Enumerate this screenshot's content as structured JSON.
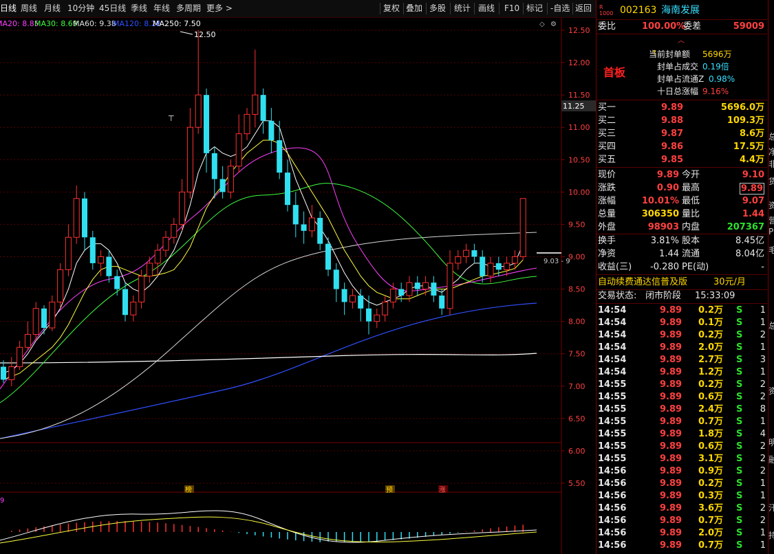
{
  "toolbar": {
    "tabs": [
      "日线",
      "周线",
      "月线",
      "10分钟",
      "45日线",
      "季线",
      "年线",
      "多周期",
      "更多 >"
    ],
    "actions": [
      "复权",
      "叠加",
      "多股",
      "统计",
      "画线",
      "F10",
      "标记",
      "-自选",
      "返回"
    ]
  },
  "ma_legend": [
    {
      "label": "MA20: 8.85",
      "color": "#ff40ff"
    },
    {
      "label": "MA30: 8.69",
      "color": "#40ff40"
    },
    {
      "label": "MA60: 9.38",
      "color": "#e0e0e0"
    },
    {
      "label": "MA120: 8.28",
      "color": "#3050ff"
    },
    {
      "label": "MA250: 7.50",
      "color": "#ffffff"
    }
  ],
  "chart_labels": {
    "high_marker": "12.50",
    "last_price_tag": "11.25",
    "low_marker": "9.03 - 9",
    "events": [
      "榜",
      "预",
      "涨"
    ],
    "macd_marker": "9"
  },
  "price_axis": [
    "12.50",
    "12.00",
    "11.50",
    "11.00",
    "10.50",
    "10.00",
    "9.50",
    "9.00",
    "8.50",
    "8.00",
    "7.50",
    "7.00",
    "6.50",
    "6.00",
    "5.50"
  ],
  "colors": {
    "up": "#ff3030",
    "down": "#30e0f0",
    "ma5": "#ffffff",
    "ma10": "#ffff40",
    "ma20": "#ff40ff",
    "ma30": "#40ff40",
    "ma60": "#e0e0e0",
    "ma120": "#3050ff",
    "ma250": "#ffffff"
  },
  "chart_data": {
    "type": "candlestick",
    "ylim": [
      5.3,
      12.7
    ],
    "candles": [
      [
        7.3,
        7.1,
        7.4,
        7.05
      ],
      [
        7.1,
        7.3,
        7.45,
        7.0
      ],
      [
        7.3,
        7.6,
        7.7,
        7.25
      ],
      [
        7.6,
        7.8,
        8.0,
        7.55
      ],
      [
        7.8,
        8.2,
        8.3,
        7.7
      ],
      [
        8.2,
        7.9,
        8.25,
        7.8
      ],
      [
        7.9,
        8.3,
        8.4,
        7.85
      ],
      [
        8.3,
        8.8,
        8.9,
        8.2
      ],
      [
        8.8,
        9.3,
        9.5,
        8.7
      ],
      [
        9.3,
        9.9,
        10.1,
        9.2
      ],
      [
        9.9,
        9.3,
        10.0,
        9.1
      ],
      [
        9.3,
        8.9,
        9.4,
        8.8
      ],
      [
        8.9,
        9.0,
        9.1,
        8.7
      ],
      [
        9.0,
        8.7,
        9.1,
        8.6
      ],
      [
        8.7,
        8.5,
        8.8,
        8.4
      ],
      [
        8.5,
        8.1,
        8.6,
        8.0
      ],
      [
        8.1,
        8.3,
        8.4,
        8.0
      ],
      [
        8.3,
        8.7,
        8.8,
        8.2
      ],
      [
        8.7,
        8.9,
        9.0,
        8.6
      ],
      [
        8.9,
        9.1,
        9.2,
        8.7
      ],
      [
        9.1,
        9.3,
        9.4,
        9.0
      ],
      [
        9.3,
        9.5,
        9.6,
        9.2
      ],
      [
        9.5,
        10.0,
        10.2,
        9.4
      ],
      [
        10.0,
        11.0,
        11.3,
        9.9
      ],
      [
        11.0,
        11.5,
        12.5,
        10.9
      ],
      [
        11.5,
        10.6,
        11.6,
        10.3
      ],
      [
        10.6,
        10.2,
        10.7,
        9.9
      ],
      [
        10.2,
        10.0,
        10.4,
        9.9
      ],
      [
        10.0,
        10.4,
        10.5,
        9.9
      ],
      [
        10.4,
        10.9,
        11.2,
        10.3
      ],
      [
        10.9,
        11.2,
        11.3,
        10.8
      ],
      [
        11.2,
        11.5,
        12.2,
        11.0
      ],
      [
        11.5,
        11.1,
        11.6,
        10.9
      ],
      [
        11.1,
        10.8,
        11.3,
        10.6
      ],
      [
        10.8,
        10.3,
        11.1,
        10.2
      ],
      [
        10.3,
        9.8,
        10.5,
        9.7
      ],
      [
        9.8,
        9.5,
        10.0,
        9.3
      ],
      [
        9.5,
        9.4,
        9.7,
        9.2
      ],
      [
        9.4,
        9.6,
        9.8,
        9.3
      ],
      [
        9.6,
        9.2,
        9.7,
        9.1
      ],
      [
        9.2,
        8.8,
        9.3,
        8.7
      ],
      [
        8.8,
        8.5,
        8.9,
        8.3
      ],
      [
        8.5,
        8.3,
        8.6,
        8.1
      ],
      [
        8.3,
        8.4,
        8.5,
        8.2
      ],
      [
        8.4,
        8.2,
        8.5,
        8.0
      ],
      [
        8.2,
        8.0,
        8.4,
        7.8
      ],
      [
        8.0,
        8.1,
        8.2,
        7.9
      ],
      [
        8.1,
        8.3,
        8.4,
        8.0
      ],
      [
        8.3,
        8.5,
        8.6,
        8.2
      ],
      [
        8.5,
        8.4,
        8.6,
        8.3
      ],
      [
        8.4,
        8.6,
        8.7,
        8.3
      ],
      [
        8.6,
        8.5,
        8.7,
        8.4
      ],
      [
        8.5,
        8.6,
        8.7,
        8.4
      ],
      [
        8.6,
        8.4,
        8.7,
        8.3
      ],
      [
        8.4,
        8.2,
        8.5,
        8.1
      ],
      [
        8.2,
        8.9,
        9.1,
        8.1
      ],
      [
        8.9,
        9.0,
        9.1,
        8.8
      ],
      [
        9.0,
        9.1,
        9.2,
        8.9
      ],
      [
        9.1,
        9.0,
        9.2,
        8.9
      ],
      [
        9.0,
        8.7,
        9.1,
        8.6
      ],
      [
        8.7,
        8.9,
        9.0,
        8.6
      ],
      [
        8.9,
        8.8,
        9.0,
        8.7
      ],
      [
        8.8,
        8.9,
        9.0,
        8.7
      ],
      [
        8.9,
        9.0,
        9.1,
        8.8
      ],
      [
        9.0,
        9.9,
        9.9,
        8.95
      ]
    ],
    "ma5": [
      7.2,
      7.25,
      7.35,
      7.5,
      7.7,
      7.85,
      8.0,
      8.2,
      8.5,
      8.9,
      9.1,
      9.2,
      9.2,
      9.1,
      8.9,
      8.6,
      8.5,
      8.45,
      8.55,
      8.7,
      8.9,
      9.1,
      9.4,
      9.8,
      10.3,
      10.6,
      10.7,
      10.6,
      10.55,
      10.6,
      10.7,
      10.9,
      11.1,
      11.1,
      11.0,
      10.6,
      10.2,
      9.9,
      9.6,
      9.45,
      9.25,
      9.0,
      8.75,
      8.55,
      8.4,
      8.3,
      8.25,
      8.3,
      8.35,
      8.4,
      8.5,
      8.55,
      8.55,
      8.5,
      8.45,
      8.55,
      8.65,
      8.8,
      8.9,
      8.9,
      8.85,
      8.85,
      8.85,
      8.9,
      9.2
    ],
    "ma10": [
      7.1,
      7.15,
      7.2,
      7.3,
      7.4,
      7.5,
      7.6,
      7.75,
      7.95,
      8.2,
      8.45,
      8.65,
      8.8,
      8.85,
      8.85,
      8.8,
      8.75,
      8.7,
      8.7,
      8.72,
      8.75,
      8.8,
      8.95,
      9.15,
      9.45,
      9.75,
      9.95,
      10.1,
      10.3,
      10.45,
      10.6,
      10.7,
      10.8,
      10.8,
      10.75,
      10.6,
      10.4,
      10.2,
      10.0,
      9.8,
      9.6,
      9.35,
      9.1,
      8.9,
      8.7,
      8.55,
      8.45,
      8.4,
      8.35,
      8.35,
      8.35,
      8.4,
      8.45,
      8.5,
      8.5,
      8.5,
      8.55,
      8.6,
      8.65,
      8.7,
      8.72,
      8.75,
      8.78,
      8.82,
      8.95
    ]
  },
  "panel": {
    "code": "002163",
    "name": "海南发展",
    "wb_label": "委比",
    "wb_value": "100.00%",
    "wc_label": "委差",
    "wc_value": "59009",
    "tag": "首板",
    "seal_rows": [
      {
        "label": "当前封单额",
        "value": "5696万",
        "color": "#ffd800"
      },
      {
        "label": "封单占成交",
        "value": "0.19倍",
        "color": "#36e0ff"
      },
      {
        "label": "封单占流通Z",
        "value": "0.98%",
        "color": "#36e0ff"
      },
      {
        "label": "十日总涨幅",
        "value": "9.16%",
        "color": "#ff4040"
      }
    ],
    "bids": [
      {
        "label": "买一",
        "price": "9.89",
        "vol": "5696.0万"
      },
      {
        "label": "买二",
        "price": "9.88",
        "vol": "109.3万"
      },
      {
        "label": "买三",
        "price": "9.87",
        "vol": "8.6万"
      },
      {
        "label": "买四",
        "price": "9.86",
        "vol": "17.5万"
      },
      {
        "label": "买五",
        "price": "9.85",
        "vol": "4.4万"
      }
    ],
    "quote": [
      {
        "l1": "现价",
        "v1": "9.89",
        "c1": "red",
        "l2": "今开",
        "v2": "9.10",
        "c2": "red"
      },
      {
        "l1": "涨跌",
        "v1": "0.90",
        "c1": "red",
        "l2": "最高",
        "v2": "9.89",
        "c2": "red"
      },
      {
        "l1": "涨幅",
        "v1": "10.01%",
        "c1": "red",
        "l2": "最低",
        "v2": "9.07",
        "c2": "red"
      },
      {
        "l1": "总量",
        "v1": "306350",
        "c1": "yellow",
        "l2": "量比",
        "v2": "1.44",
        "c2": "red"
      },
      {
        "l1": "外盘",
        "v1": "98903",
        "c1": "red",
        "l2": "内盘",
        "v2": "207367",
        "c2": "green"
      }
    ],
    "fin": [
      {
        "l1": "换手",
        "v1": "3.81%",
        "l2": "股本",
        "v2": "8.45亿"
      },
      {
        "l1": "净资",
        "v1": "1.44",
        "l2": "流通",
        "v2": "8.04亿"
      },
      {
        "l1": "收益(三)",
        "v1": "-0.280",
        "l2": "PE(动)",
        "v2": "-"
      }
    ],
    "promo": "自动续费通达信普及版",
    "promo_price": "30元/月",
    "trade_status_label": "交易状态:",
    "trade_status": "闭市阶段",
    "trade_time": "15:33:09",
    "ticks": [
      {
        "t": "14:54",
        "p": "9.89",
        "v": "0.2万",
        "s": "S",
        "n": "1"
      },
      {
        "t": "14:54",
        "p": "9.89",
        "v": "0.1万",
        "s": "S",
        "n": "1"
      },
      {
        "t": "14:54",
        "p": "9.89",
        "v": "0.2万",
        "s": "S",
        "n": "2"
      },
      {
        "t": "14:54",
        "p": "9.89",
        "v": "2.0万",
        "s": "S",
        "n": "1"
      },
      {
        "t": "14:54",
        "p": "9.89",
        "v": "2.7万",
        "s": "S",
        "n": "3"
      },
      {
        "t": "14:54",
        "p": "9.89",
        "v": "1.2万",
        "s": "S",
        "n": "1"
      },
      {
        "t": "14:55",
        "p": "9.89",
        "v": "0.2万",
        "s": "S",
        "n": "2"
      },
      {
        "t": "14:55",
        "p": "9.89",
        "v": "0.6万",
        "s": "S",
        "n": "2"
      },
      {
        "t": "14:55",
        "p": "9.89",
        "v": "2.4万",
        "s": "S",
        "n": "8"
      },
      {
        "t": "14:55",
        "p": "9.89",
        "v": "0.7万",
        "s": "S",
        "n": "1"
      },
      {
        "t": "14:55",
        "p": "9.89",
        "v": "1.8万",
        "s": "S",
        "n": "4"
      },
      {
        "t": "14:55",
        "p": "9.89",
        "v": "0.6万",
        "s": "S",
        "n": "2"
      },
      {
        "t": "14:55",
        "p": "9.89",
        "v": "3.1万",
        "s": "S",
        "n": "2"
      },
      {
        "t": "14:56",
        "p": "9.89",
        "v": "0.9万",
        "s": "S",
        "n": "2"
      },
      {
        "t": "14:56",
        "p": "9.89",
        "v": "0.2万",
        "s": "S",
        "n": "1"
      },
      {
        "t": "14:56",
        "p": "9.89",
        "v": "0.3万",
        "s": "S",
        "n": "1"
      },
      {
        "t": "14:56",
        "p": "9.89",
        "v": "3.6万",
        "s": "S",
        "n": "2"
      },
      {
        "t": "14:56",
        "p": "9.89",
        "v": "0.7万",
        "s": "S",
        "n": "2"
      },
      {
        "t": "14:56",
        "p": "9.89",
        "v": "2.0万",
        "s": "S",
        "n": "1"
      },
      {
        "t": "14:56",
        "p": "9.89",
        "v": "0.7万",
        "s": "S",
        "n": "1"
      }
    ]
  },
  "edge_chars": [
    "总",
    "净",
    "非",
    "货",
    "资",
    "营",
    "P",
    "毛",
    "",
    "",
    " ",
    "总",
    "",
    "资",
    "明",
    "融",
    "",
    "汗",
    "持"
  ]
}
